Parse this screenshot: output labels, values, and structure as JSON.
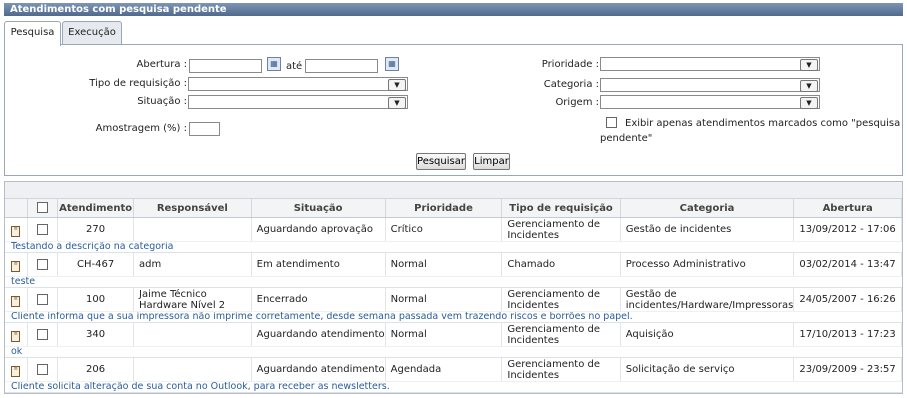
{
  "window": {
    "title": "Atendimentos com pesquisa pendente"
  },
  "tabs": [
    {
      "label": "Pesquisa",
      "active": true
    },
    {
      "label": "Execução",
      "active": false
    }
  ],
  "form": {
    "abertura_label": "Abertura :",
    "ate_label": "até",
    "abertura_inicio": "",
    "abertura_fim": "",
    "tipo_label": "Tipo de requisição :",
    "tipo_value": "",
    "situacao_label": "Situação :",
    "situacao_value": "",
    "amostragem_label": "Amostragem (%) :",
    "amostragem_value": "",
    "prioridade_label": "Prioridade :",
    "prioridade_value": "",
    "categoria_label": "Categoria :",
    "categoria_value": "",
    "origem_label": "Origem :",
    "origem_value": "",
    "exibir_label_1": "Exibir apenas atendimentos marcados como \"pesquisa",
    "exibir_label_2": "pendente\"",
    "pesquisar_label": "Pesquisar",
    "limpar_label": "Limpar"
  },
  "table": {
    "headers": [
      "Atendimento",
      "Responsável",
      "Situação",
      "Prioridade",
      "Tipo de requisição",
      "Categoria",
      "Abertura"
    ],
    "rows": [
      {
        "atendimento": "270",
        "responsavel": "",
        "situacao": "Aguardando aprovação",
        "prioridade": "Crítico",
        "tipo": "Gerenciamento de Incidentes",
        "categoria": "Gestão de incidentes",
        "abertura": "13/09/2012 - 17:06",
        "descricao": "Testando a descrição na categoria"
      },
      {
        "atendimento": "CH-467",
        "responsavel": "adm",
        "situacao": "Em atendimento",
        "prioridade": "Normal",
        "tipo": "Chamado",
        "categoria": "Processo Administrativo",
        "abertura": "03/02/2014 - 13:47",
        "descricao": "teste"
      },
      {
        "atendimento": "100",
        "responsavel": "Jaime Técnico Hardware Nível 2",
        "situacao": "Encerrado",
        "prioridade": "Normal",
        "tipo": "Gerenciamento de Incidentes",
        "categoria": "Gestão de incidentes/Hardware/Impressoras",
        "abertura": "24/05/2007 - 16:26",
        "descricao": "Cliente  informa que a sua impressora não imprime corretamente, desde semana passada vem trazendo riscos e borrões no papel."
      },
      {
        "atendimento": "340",
        "responsavel": "",
        "situacao": "Aguardando atendimento",
        "prioridade": "Normal",
        "tipo": "Gerenciamento de Incidentes",
        "categoria": "Aquisição",
        "abertura": "17/10/2013 - 17:23",
        "descricao": "ok"
      },
      {
        "atendimento": "206",
        "responsavel": "",
        "situacao": "Aguardando atendimento",
        "prioridade": "Agendada",
        "tipo": "Gerenciamento de Incidentes",
        "categoria": "Solicitação de serviço",
        "abertura": "23/09/2009 - 23:57",
        "descricao": "Cliente solicita alteração de sua conta no Outlook, para receber as newsletters."
      }
    ]
  }
}
